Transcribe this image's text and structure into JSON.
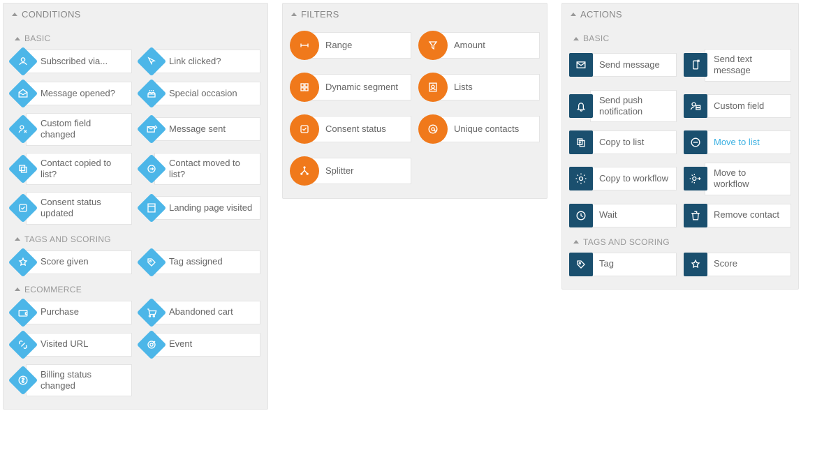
{
  "columns": {
    "conditions": {
      "title": "CONDITIONS",
      "groups": [
        {
          "name": "BASIC",
          "items": [
            {
              "icon": "user",
              "label": "Subscribed via..."
            },
            {
              "icon": "cursor",
              "label": "Link clicked?"
            },
            {
              "icon": "envelope-open",
              "label": "Message opened?"
            },
            {
              "icon": "cake",
              "label": "Special occasion"
            },
            {
              "icon": "user-edit",
              "label": "Custom field changed"
            },
            {
              "icon": "envelope-send",
              "label": "Message sent"
            },
            {
              "icon": "copy",
              "label": "Contact copied to list?"
            },
            {
              "icon": "move",
              "label": "Contact moved to list?"
            },
            {
              "icon": "check-box",
              "label": "Consent status updated"
            },
            {
              "icon": "page",
              "label": "Landing page visited"
            }
          ]
        },
        {
          "name": "TAGS AND SCORING",
          "items": [
            {
              "icon": "star",
              "label": "Score given"
            },
            {
              "icon": "tag",
              "label": "Tag assigned"
            }
          ]
        },
        {
          "name": "ECOMMERCE",
          "items": [
            {
              "icon": "wallet",
              "label": "Purchase"
            },
            {
              "icon": "cart",
              "label": "Abandoned cart"
            },
            {
              "icon": "link",
              "label": "Visited URL"
            },
            {
              "icon": "target",
              "label": "Event"
            },
            {
              "icon": "dollar",
              "label": "Billing status changed"
            }
          ]
        }
      ]
    },
    "filters": {
      "title": "FILTERS",
      "items": [
        {
          "icon": "range",
          "label": "Range"
        },
        {
          "icon": "funnel",
          "label": "Amount"
        },
        {
          "icon": "grid",
          "label": "Dynamic segment"
        },
        {
          "icon": "contacts",
          "label": "Lists"
        },
        {
          "icon": "check-box",
          "label": "Consent status"
        },
        {
          "icon": "at",
          "label": "Unique contacts"
        },
        {
          "icon": "split",
          "label": "Splitter"
        }
      ]
    },
    "actions": {
      "title": "ACTIONS",
      "groups": [
        {
          "name": "BASIC",
          "items": [
            {
              "icon": "envelope",
              "label": "Send message"
            },
            {
              "icon": "phone-out",
              "label": "Send text message"
            },
            {
              "icon": "bell",
              "label": "Send push notification"
            },
            {
              "icon": "user-field",
              "label": "Custom field"
            },
            {
              "icon": "copy-list",
              "label": "Copy to list"
            },
            {
              "icon": "move-list",
              "label": "Move to list",
              "highlight": true
            },
            {
              "icon": "gear",
              "label": "Copy to workflow"
            },
            {
              "icon": "gear-move",
              "label": "Move to workflow"
            },
            {
              "icon": "clock",
              "label": "Wait"
            },
            {
              "icon": "trash",
              "label": "Remove contact"
            }
          ]
        },
        {
          "name": "TAGS AND SCORING",
          "items": [
            {
              "icon": "tag",
              "label": "Tag"
            },
            {
              "icon": "star",
              "label": "Score"
            }
          ]
        }
      ]
    }
  }
}
